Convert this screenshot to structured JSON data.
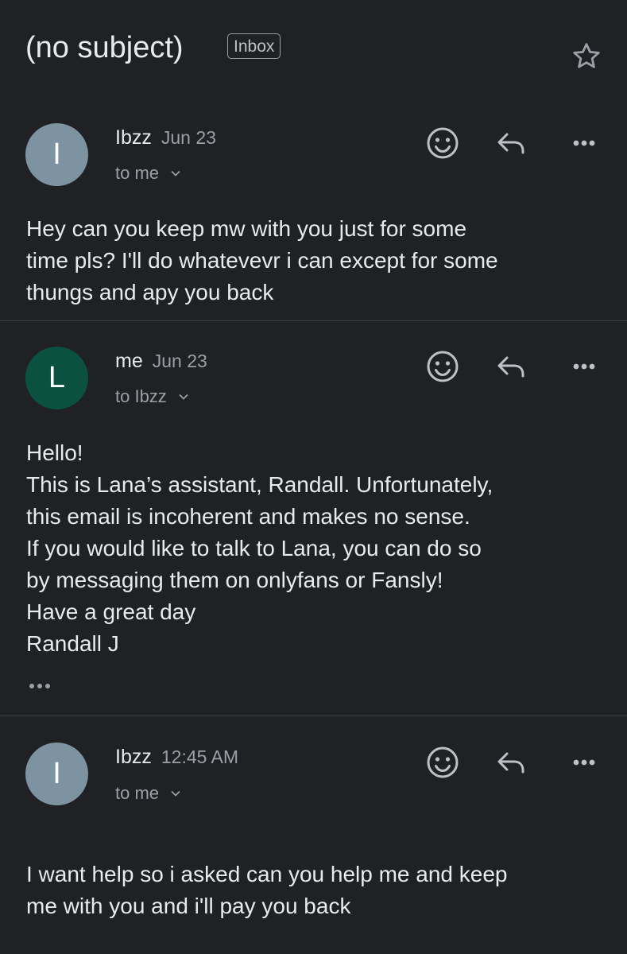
{
  "header": {
    "subject": "(no subject)",
    "label": "Inbox",
    "star_icon": "star-icon"
  },
  "messages": [
    {
      "avatar_letter": "I",
      "avatar_color": "#7e93a1",
      "sender": "Ibzz",
      "date": "Jun 23",
      "recipient": "to me",
      "body": [
        "Hey can you keep mw with you just for some",
        "time pls? I'll do whatevevr i can except for some",
        "thungs and apy you back"
      ]
    },
    {
      "avatar_letter": "L",
      "avatar_color": "#0b5142",
      "sender": "me",
      "date": "Jun 23",
      "recipient": "to Ibzz",
      "body": [
        "Hello!",
        "This is Lana’s assistant, Randall. Unfortunately,",
        "this email is incoherent and makes no sense.",
        "If you would like to talk to Lana, you can do so",
        "by messaging them on onlyfans or Fansly!",
        "Have a great day",
        "Randall J"
      ],
      "has_trimmed_content": true
    },
    {
      "avatar_letter": "I",
      "avatar_color": "#7e93a1",
      "sender": "Ibzz",
      "date": "12:45 AM",
      "recipient": "to me",
      "body": [
        "I want help so i asked can you help me and keep",
        "me with you and i'll pay you back"
      ]
    }
  ],
  "icons": {
    "react": "emoji-smile-icon",
    "reply": "reply-icon",
    "more": "more-horizontal-icon",
    "expand": "chevron-down-icon"
  }
}
